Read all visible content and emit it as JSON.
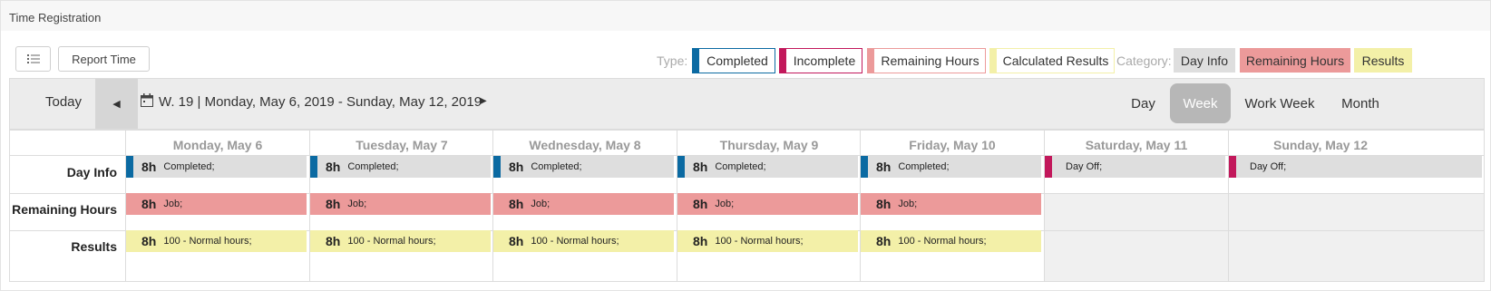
{
  "panel": {
    "title": "Time Registration"
  },
  "toolbar_top": {
    "list_icon": "list-icon",
    "report_time_label": "Report Time"
  },
  "legend": {
    "type_label": "Type:",
    "types": [
      {
        "label": "Completed",
        "color": "#0b6aa2"
      },
      {
        "label": "Incomplete",
        "color": "#c2185b"
      },
      {
        "label": "Remaining Hours",
        "color": "#ec9a9a"
      },
      {
        "label": "Calculated Results",
        "color": "#f3f0a8"
      }
    ],
    "category_label": "Category:",
    "categories": [
      {
        "label": "Day Info",
        "color": "#dedede"
      },
      {
        "label": "Remaining Hours",
        "color": "#ec9a9a"
      },
      {
        "label": "Results",
        "color": "#f3f0a8"
      }
    ]
  },
  "nav": {
    "today_label": "Today",
    "prev_icon": "triangle-left-icon",
    "calendar_icon": "calendar-icon",
    "date_range": "W. 19 | Monday, May 6, 2019 - Sunday, May 12, 2019",
    "next_icon": "triangle-right-icon",
    "views": [
      "Day",
      "Week",
      "Work Week",
      "Month"
    ],
    "active_view": "Week"
  },
  "calendar": {
    "days": [
      "Monday, May 6",
      "Tuesday, May 7",
      "Wednesday, May 8",
      "Thursday, May 9",
      "Friday, May 10",
      "Saturday, May 11",
      "Sunday, May 12"
    ],
    "rows": [
      "Day Info",
      "Remaining Hours",
      "Results"
    ],
    "day_info": [
      {
        "hours": "8h",
        "text": "Completed;",
        "status": "completed"
      },
      {
        "hours": "8h",
        "text": "Completed;",
        "status": "completed"
      },
      {
        "hours": "8h",
        "text": "Completed;",
        "status": "completed"
      },
      {
        "hours": "8h",
        "text": "Completed;",
        "status": "completed"
      },
      {
        "hours": "8h",
        "text": "Completed;",
        "status": "completed"
      },
      {
        "hours": "",
        "text": "Day Off;",
        "status": "incomplete"
      },
      {
        "hours": "",
        "text": "Day Off;",
        "status": "incomplete"
      }
    ],
    "remaining": [
      {
        "hours": "8h",
        "text": "Job;"
      },
      {
        "hours": "8h",
        "text": "Job;"
      },
      {
        "hours": "8h",
        "text": "Job;"
      },
      {
        "hours": "8h",
        "text": "Job;"
      },
      {
        "hours": "8h",
        "text": "Job;"
      }
    ],
    "results": [
      {
        "hours": "8h",
        "text": "100 - Normal hours;"
      },
      {
        "hours": "8h",
        "text": "100 - Normal hours;"
      },
      {
        "hours": "8h",
        "text": "100 - Normal hours;"
      },
      {
        "hours": "8h",
        "text": "100 - Normal hours;"
      },
      {
        "hours": "8h",
        "text": "100 - Normal hours;"
      }
    ]
  }
}
